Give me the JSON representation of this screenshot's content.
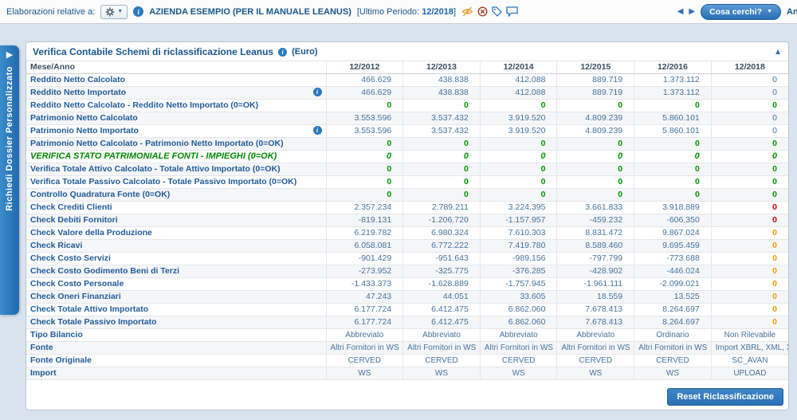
{
  "topbar": {
    "label": "Elaborazioni relative a:",
    "company": "AZIENDA ESEMPIO (PER IL MANUALE LEANUS)",
    "period_prefix": "[Ultimo Periodo:",
    "period_value": "12/2018",
    "period_suffix": "]",
    "search_button": "Cosa cerchi?",
    "partial_right_text": "Ana"
  },
  "icons": {
    "caret_down": "▼",
    "collapse_up": "▲",
    "prev": "◀",
    "next": "▶",
    "sidebar_arrow": "▶",
    "info": "i"
  },
  "colors": {
    "accent_blue": "#2a6fb5",
    "dark_blue_text": "#17578c",
    "value_blue": "#44749f",
    "ok_green": "#009900",
    "warn_orange": "#f59b00",
    "error_red": "#cc0000",
    "sidebar_blue": "#1f69ad"
  },
  "sidebar": {
    "tab_label": "Richiedi Dossier Personalizzato"
  },
  "panel": {
    "title": "Verifica Contabile Schemi di riclassificazione Leanus",
    "unit": "(Euro)",
    "reset_button": "Reset Riclassificazione"
  },
  "table": {
    "header": [
      "Mese/Anno",
      "12/2012",
      "12/2013",
      "12/2014",
      "12/2015",
      "12/2016",
      "12/2018"
    ],
    "rows": [
      {
        "label": "Reddito Netto Calcolato",
        "type": "num",
        "last": "blue",
        "values": [
          "466.629",
          "438.838",
          "412.088",
          "889.719",
          "1.373.112",
          "0"
        ]
      },
      {
        "label": "Reddito Netto Importato",
        "info": true,
        "type": "num",
        "last": "blue",
        "values": [
          "466.629",
          "438.838",
          "412.088",
          "889.719",
          "1.373.112",
          "0"
        ]
      },
      {
        "label": "Reddito Netto Calcolato - Reddito Netto Importato (0=OK)",
        "type": "green",
        "values": [
          "0",
          "0",
          "0",
          "0",
          "0",
          "0"
        ]
      },
      {
        "label": "Patrimonio Netto Calcolato",
        "type": "num",
        "last": "blue",
        "values": [
          "3.553.596",
          "3.537.432",
          "3.919.520",
          "4.809.239",
          "5.860.101",
          "0"
        ]
      },
      {
        "label": "Patrimonio Netto Importato",
        "info": true,
        "type": "num",
        "last": "blue",
        "values": [
          "3.553.596",
          "3.537.432",
          "3.919.520",
          "4.809.239",
          "5.860.101",
          "0"
        ]
      },
      {
        "label": "Patrimonio Netto Calcolato - Patrimonio Netto Importato (0=OK)",
        "type": "green",
        "values": [
          "0",
          "0",
          "0",
          "0",
          "0",
          "0"
        ]
      },
      {
        "label": "VERIFICA STATO PATRIMONIALE FONTI - IMPIEGHI (0=OK)",
        "type": "verify",
        "values": [
          "0",
          "0",
          "0",
          "0",
          "0",
          "0"
        ]
      },
      {
        "label": "Verifica Totale Attivo Calcolato - Totale Attivo Importato (0=OK)",
        "type": "green",
        "values": [
          "0",
          "0",
          "0",
          "0",
          "0",
          "0"
        ]
      },
      {
        "label": "Verifica Totale Passivo Calcolato - Totale Passivo Importato (0=OK)",
        "type": "green",
        "values": [
          "0",
          "0",
          "0",
          "0",
          "0",
          "0"
        ]
      },
      {
        "label": "Controllo Quadratura Fonte (0=OK)",
        "type": "green",
        "values": [
          "0",
          "0",
          "0",
          "0",
          "0",
          "0"
        ]
      },
      {
        "label": "Check Crediti Clienti",
        "type": "num",
        "last": "red",
        "values": [
          "2.357.234",
          "2.789.211",
          "3.224.395",
          "3.661.833",
          "3.918.889",
          "0"
        ]
      },
      {
        "label": "Check Debiti Fornitori",
        "type": "num",
        "last": "red",
        "values": [
          "-819.131",
          "-1.206.720",
          "-1.157.957",
          "-459.232",
          "-606.350",
          "0"
        ]
      },
      {
        "label": "Check Valore della Produzione",
        "type": "num",
        "last": "orange",
        "values": [
          "6.219.782",
          "6.980.324",
          "7.610.303",
          "8.831.472",
          "9.867.024",
          "0"
        ]
      },
      {
        "label": "Check Ricavi",
        "type": "num",
        "last": "orange",
        "values": [
          "6.058.081",
          "6.772.222",
          "7.419.780",
          "8.589.460",
          "9.695.459",
          "0"
        ]
      },
      {
        "label": "Check Costo Servizi",
        "type": "num",
        "last": "orange",
        "values": [
          "-901.429",
          "-951.643",
          "-989.156",
          "-797.799",
          "-773.688",
          "0"
        ]
      },
      {
        "label": "Check Costo Godimento Beni di Terzi",
        "type": "num",
        "last": "orange",
        "values": [
          "-273.952",
          "-325.775",
          "-376.285",
          "-428.902",
          "-446.024",
          "0"
        ]
      },
      {
        "label": "Check Costo Personale",
        "type": "num",
        "last": "orange",
        "values": [
          "-1.433.373",
          "-1.628.889",
          "-1.757.945",
          "-1.961.111",
          "-2.099.021",
          "0"
        ]
      },
      {
        "label": "Check Oneri Finanziari",
        "type": "num",
        "last": "orange",
        "values": [
          "47.243",
          "44.051",
          "33.605",
          "18.559",
          "13.525",
          "0"
        ]
      },
      {
        "label": "Check Totale Attivo Importato",
        "type": "num",
        "last": "orange",
        "values": [
          "6.177.724",
          "6.412.475",
          "6.862.060",
          "7.678.413",
          "8.264.697",
          "0"
        ]
      },
      {
        "label": "Check Totale Passivo Importato",
        "type": "num",
        "last": "orange",
        "values": [
          "6.177.724",
          "6.412.475",
          "6.862.060",
          "7.678.413",
          "8.264.697",
          "0"
        ]
      },
      {
        "label": "Tipo Bilancio",
        "type": "text",
        "values": [
          "Abbreviato",
          "Abbreviato",
          "Abbreviato",
          "Abbreviato",
          "Ordinario",
          "Non Rilevabile"
        ]
      },
      {
        "label": "Fonte",
        "type": "text",
        "values": [
          "Altri Fornitori in WS",
          "Altri Fornitori in WS",
          "Altri Fornitori in WS",
          "Altri Fornitori in WS",
          "Altri Fornitori in WS",
          "Import XBRL, XML, XLS"
        ]
      },
      {
        "label": "Fonte Originale",
        "type": "text",
        "values": [
          "CERVED",
          "CERVED",
          "CERVED",
          "CERVED",
          "CERVED",
          "SC_AVAN"
        ]
      },
      {
        "label": "Import",
        "type": "text",
        "values": [
          "WS",
          "WS",
          "WS",
          "WS",
          "WS",
          "UPLOAD"
        ]
      }
    ]
  }
}
